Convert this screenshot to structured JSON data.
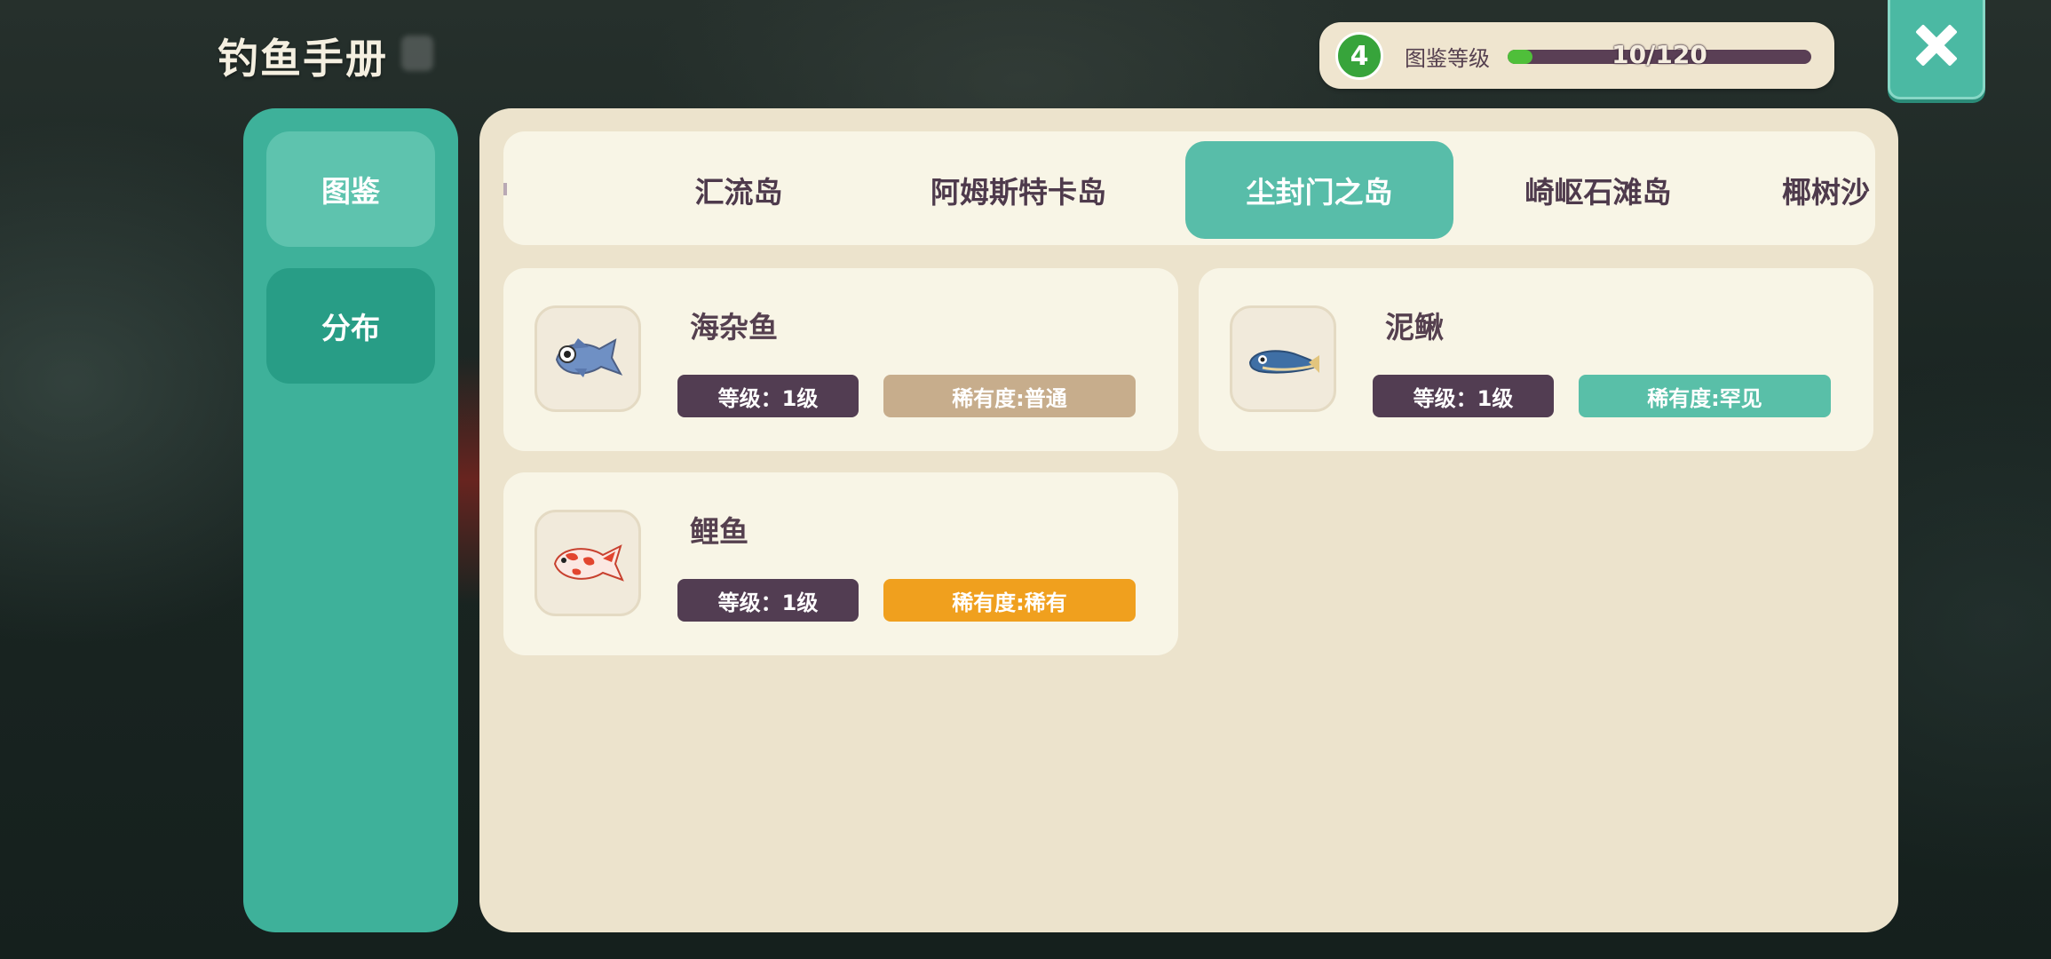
{
  "header": {
    "title": "钓鱼手册",
    "collection_level": {
      "level": "4",
      "label": "图鉴等级",
      "progress_text": "10/120",
      "progress_fraction": 0.083
    }
  },
  "sidebar": {
    "items": [
      {
        "label": "图鉴"
      },
      {
        "label": "分布"
      }
    ]
  },
  "islands": {
    "tabs": [
      {
        "label": "汇流岛"
      },
      {
        "label": "阿姆斯特卡岛"
      },
      {
        "label": "尘封门之岛",
        "active": true
      },
      {
        "label": "崎岖石滩岛"
      },
      {
        "label": "椰树沙"
      }
    ]
  },
  "fish": [
    {
      "name": "海杂鱼",
      "level": "等级：1级",
      "rarity": "稀有度:普通",
      "rarity_color": "#c7ad8c",
      "icon": "grey-fish-icon"
    },
    {
      "name": "泥鳅",
      "level": "等级：1级",
      "rarity": "稀有度:罕见",
      "rarity_color": "#59bfa8",
      "icon": "loach-icon"
    },
    {
      "name": "鲤鱼",
      "level": "等级：1级",
      "rarity": "稀有度:稀有",
      "rarity_color": "#f0a01e",
      "icon": "koi-carp-icon"
    }
  ],
  "colors": {
    "accent_teal": "#3eb19a",
    "panel_bg": "#ece3cc",
    "card_bg": "#f8f5e6",
    "level_badge": "#523d52"
  }
}
